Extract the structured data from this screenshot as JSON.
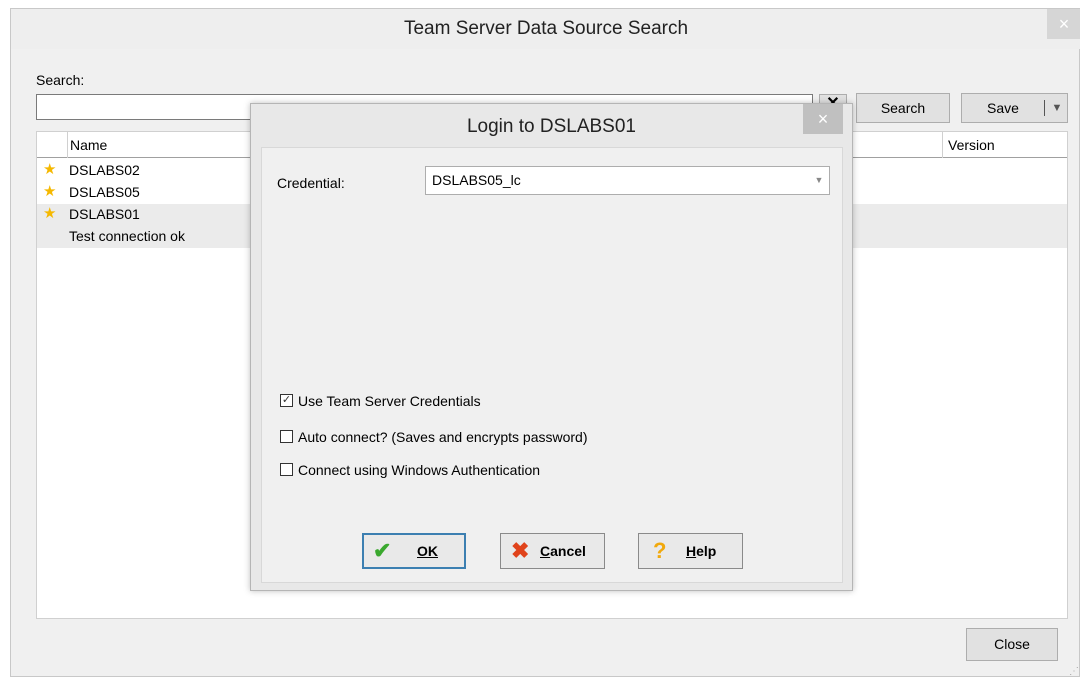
{
  "window": {
    "title": "Team Server Data Source Search",
    "close_glyph": "×"
  },
  "search": {
    "label": "Search:",
    "value": "",
    "clear_glyph": "✕",
    "button_label": "Search"
  },
  "save": {
    "label": "Save",
    "dropdown_glyph": "▼"
  },
  "list": {
    "columns": {
      "name": "Name",
      "version": "Version"
    },
    "rows": [
      {
        "name": "DSLABS02",
        "favorite": true,
        "status": ""
      },
      {
        "name": "DSLABS05",
        "favorite": true,
        "status": ""
      },
      {
        "name": "DSLABS01",
        "favorite": true,
        "status": "Test connection ok"
      }
    ],
    "star_glyph": "★"
  },
  "close_button": "Close",
  "grip_glyph": "⋰",
  "login_dialog": {
    "title": "Login to DSLABS01",
    "close_glyph": "×",
    "credential_label": "Credential:",
    "credential_value": "DSLABS05_lc",
    "dropdown_glyph": "▼",
    "checkboxes": [
      {
        "label": "Use Team Server Credentials",
        "checked": true,
        "mark": "✓"
      },
      {
        "label": "Auto connect? (Saves and encrypts password)",
        "checked": false,
        "mark": ""
      },
      {
        "label": "Connect using Windows Authentication",
        "checked": false,
        "mark": ""
      }
    ],
    "buttons": {
      "ok": {
        "label": "OK",
        "icon": "check-icon",
        "glyph": "✔"
      },
      "cancel": {
        "label": "Cancel",
        "icon": "x-icon",
        "glyph": "✖"
      },
      "help": {
        "label": "Help",
        "icon": "question-icon",
        "glyph": "?"
      }
    }
  },
  "colors": {
    "star": "#f5b800",
    "ok_check": "#3aa82e",
    "cancel_x": "#e0431b",
    "help_q": "#f1a90d",
    "focus_border": "#3c7fb1"
  }
}
